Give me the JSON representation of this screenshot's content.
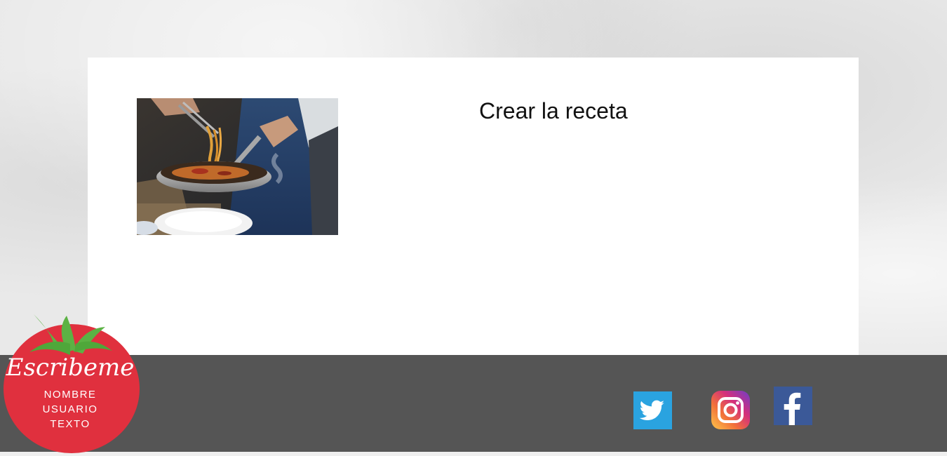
{
  "main": {
    "title": "Crear la receta",
    "image": {
      "semantic": "recipe-photo",
      "description_icon": "pasta-pan-photo"
    }
  },
  "badge": {
    "title": "Escribeme",
    "lines": [
      "NOMBRE",
      "USUARIO",
      "TEXTO"
    ],
    "colors": {
      "tomato": "#e0303e",
      "leaves": "#5cb244"
    }
  },
  "footer": {
    "background": "#555555",
    "social": [
      {
        "icon": "twitter-icon",
        "color": "#2aa3e0"
      },
      {
        "icon": "instagram-icon",
        "color": "#c13584"
      },
      {
        "icon": "facebook-icon",
        "color": "#3b5998"
      }
    ]
  }
}
